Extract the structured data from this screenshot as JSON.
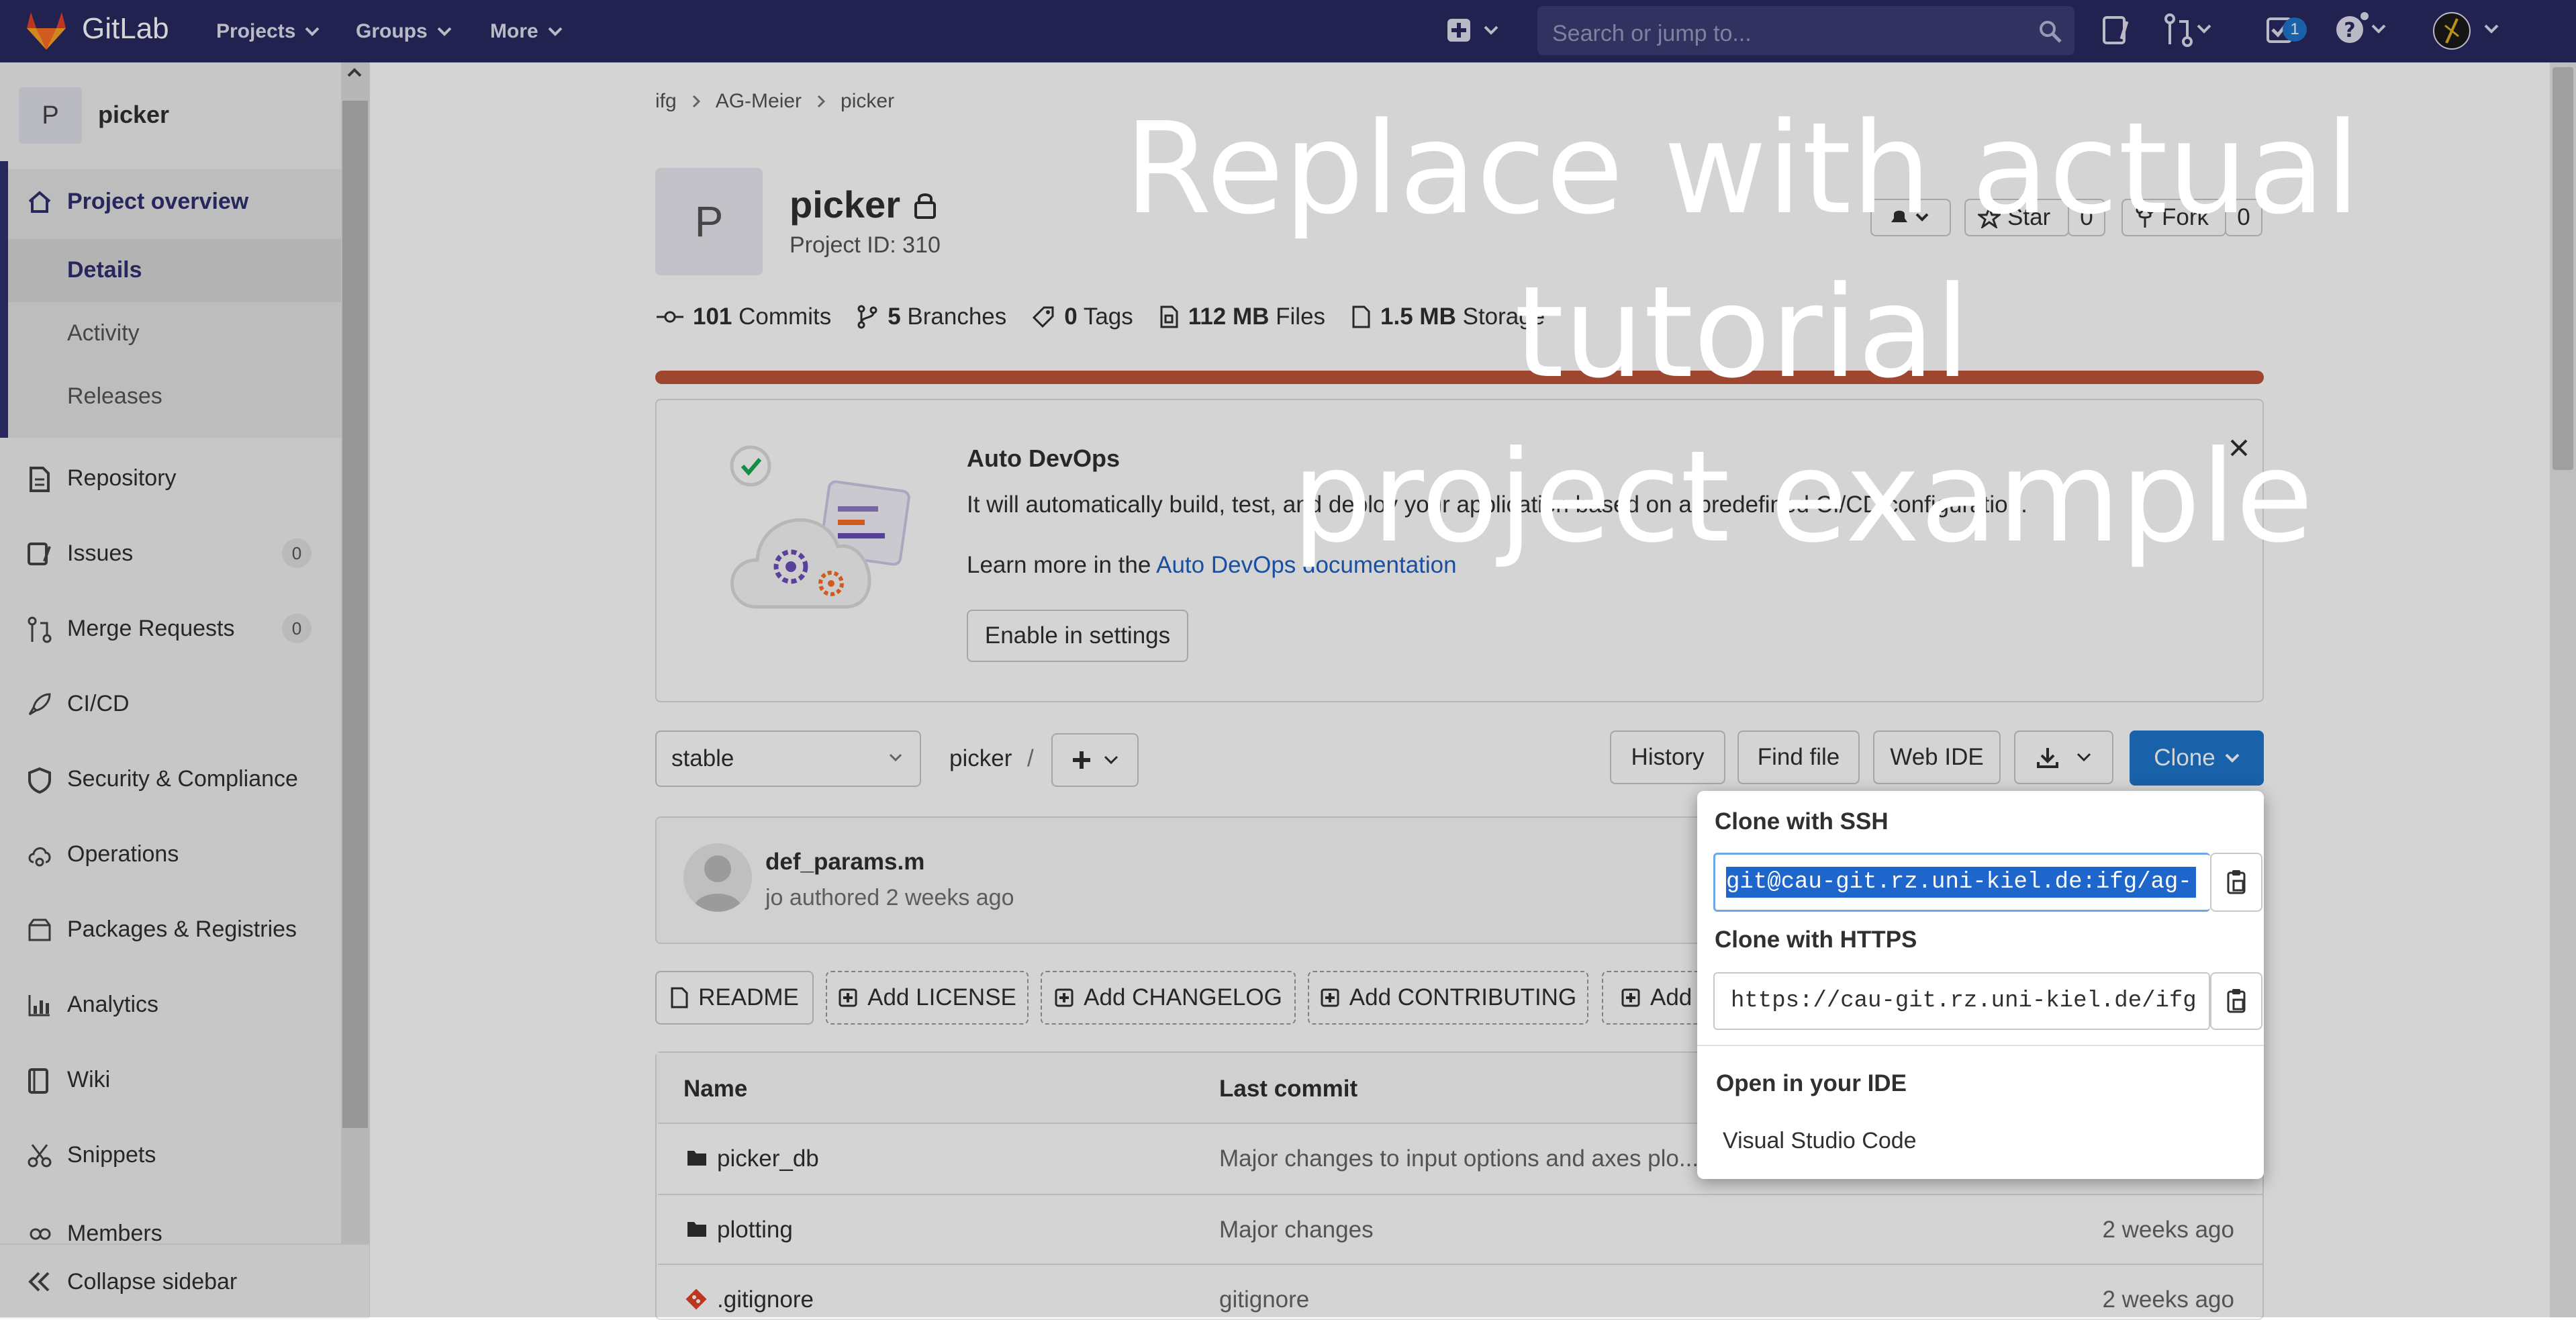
{
  "topbar": {
    "brand": "GitLab",
    "nav": [
      "Projects",
      "Groups",
      "More"
    ],
    "search_placeholder": "Search or jump to...",
    "todo_count": "1"
  },
  "sidebar": {
    "project_initial": "P",
    "project_name": "picker",
    "items": [
      {
        "label": "Project overview",
        "icon": "home-icon"
      },
      {
        "label": "Details"
      },
      {
        "label": "Activity"
      },
      {
        "label": "Releases"
      },
      {
        "label": "Repository",
        "icon": "document-icon"
      },
      {
        "label": "Issues",
        "icon": "issues-icon",
        "count": "0"
      },
      {
        "label": "Merge Requests",
        "icon": "merge-request-icon",
        "count": "0"
      },
      {
        "label": "CI/CD",
        "icon": "rocket-icon"
      },
      {
        "label": "Security & Compliance",
        "icon": "shield-icon"
      },
      {
        "label": "Operations",
        "icon": "cloud-gear-icon"
      },
      {
        "label": "Packages & Registries",
        "icon": "package-icon"
      },
      {
        "label": "Analytics",
        "icon": "chart-icon"
      },
      {
        "label": "Wiki",
        "icon": "book-icon"
      },
      {
        "label": "Snippets",
        "icon": "scissors-icon"
      },
      {
        "label": "Members",
        "icon": "users-icon"
      }
    ],
    "collapse_label": "Collapse sidebar"
  },
  "breadcrumb": [
    "ifg",
    "AG-Meier",
    "picker"
  ],
  "project": {
    "avatar_initial": "P",
    "name": "picker",
    "id_text": "Project ID: 310",
    "star_label": "Star",
    "star_count": "0",
    "fork_label": "Fork",
    "fork_count": "0"
  },
  "stats": {
    "commits_count": "101",
    "commits_label": "Commits",
    "branches_count": "5",
    "branches_label": "Branches",
    "tags_count": "0",
    "tags_label": "Tags",
    "files_size": "112 MB",
    "files_label": "Files",
    "storage_size": "1.5 MB",
    "storage_label": "Storage"
  },
  "overlay_text": [
    "Replace with actual tutorial",
    "project example"
  ],
  "devops": {
    "title": "Auto DevOps",
    "description": "It will automatically build, test, and deploy your application based on a predefined CI/CD configuration.",
    "learn_prefix": "Learn more in the",
    "learn_link": "Auto DevOps documentation",
    "enable_button": "Enable in settings"
  },
  "repo_toolbar": {
    "branch": "stable",
    "path": "picker",
    "separator": "/",
    "history": "History",
    "find_file": "Find file",
    "web_ide": "Web IDE",
    "clone": "Clone"
  },
  "commit": {
    "title": "def_params.m",
    "author": "jo",
    "meta": "authored 2 weeks ago"
  },
  "file_buttons": [
    "README",
    "Add LICENSE",
    "Add CHANGELOG",
    "Add CONTRIBUTING",
    "Add"
  ],
  "table": {
    "headers": {
      "name": "Name",
      "last_commit": "Last commit"
    },
    "rows": [
      {
        "name": "picker_db",
        "commit": "Major changes to input options and axes plo...",
        "date": ""
      },
      {
        "name": "plotting",
        "commit": "Major changes",
        "date": "2 weeks ago"
      },
      {
        "name": ".gitignore",
        "commit": "gitignore",
        "date": "2 weeks ago"
      }
    ]
  },
  "clone_dropdown": {
    "ssh_title": "Clone with SSH",
    "ssh_url": "git@cau-git.rz.uni-kiel.de:ifg/ag-",
    "https_title": "Clone with HTTPS",
    "https_url": "https://cau-git.rz.uni-kiel.de/ifg",
    "ide_title": "Open in your IDE",
    "ide_option": "Visual Studio Code"
  },
  "colors": {
    "topbar": "#292961",
    "sidebar": "#f0f0f0",
    "active_nav": "#303070",
    "primary": "#1f75cb",
    "storage_bar": "#c0553a"
  }
}
